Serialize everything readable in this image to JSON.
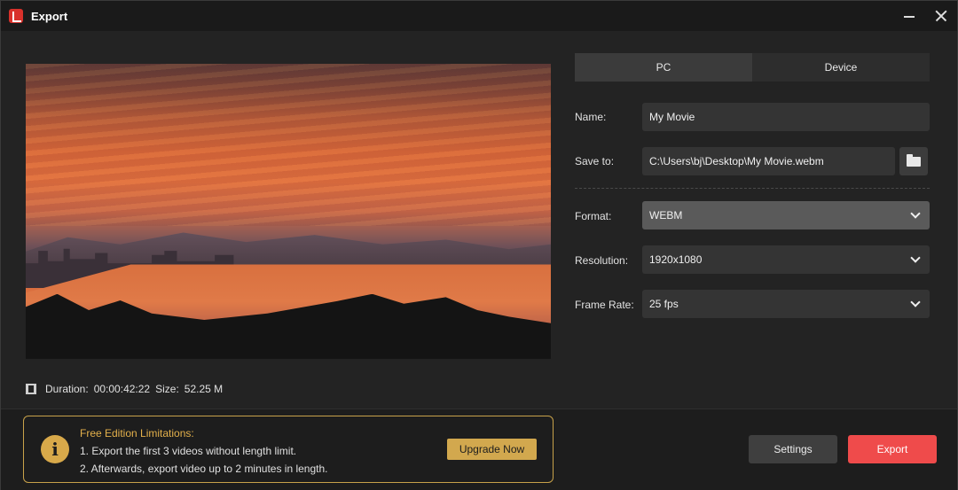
{
  "window": {
    "title": "Export",
    "logo_icon": "app-logo-icon",
    "minimize_icon": "minimize-icon",
    "close_icon": "close-icon"
  },
  "preview": {
    "duration_label": "Duration:",
    "duration_value": "00:00:42:22",
    "size_label": "Size:",
    "size_value": "52.25 M",
    "film_icon": "film-icon"
  },
  "tabs": [
    {
      "label": "PC",
      "active": true
    },
    {
      "label": "Device",
      "active": false
    }
  ],
  "form": {
    "name_label": "Name:",
    "name_value": "My Movie",
    "save_to_label": "Save to:",
    "save_to_value": "C:\\Users\\bj\\Desktop\\My Movie.webm",
    "folder_icon": "folder-icon",
    "format_label": "Format:",
    "format_value": "WEBM",
    "resolution_label": "Resolution:",
    "resolution_value": "1920x1080",
    "frame_rate_label": "Frame Rate:",
    "frame_rate_value": "25 fps"
  },
  "limitations": {
    "title": "Free Edition Limitations:",
    "line1": "1. Export the first 3 videos without length limit.",
    "line2": "2. Afterwards, export video up to 2 minutes in length.",
    "upgrade_label": "Upgrade Now",
    "info_icon": "info-icon"
  },
  "actions": {
    "settings_label": "Settings",
    "export_label": "Export"
  },
  "colors": {
    "accent": "#ef4b4b",
    "warning": "#d2a84e",
    "background": "#232323"
  }
}
